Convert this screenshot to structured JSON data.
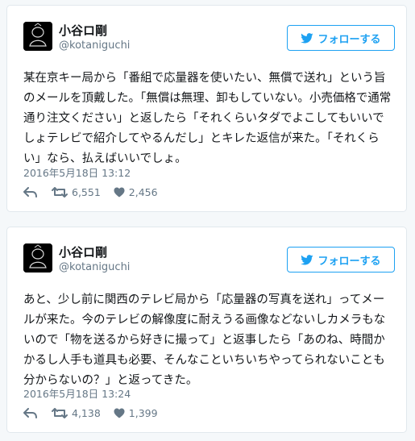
{
  "tweets": [
    {
      "display_name": "小谷ロ剛",
      "screen_name": "@kotaniguchi",
      "follow_label": "フォローする",
      "body": "某在京キー局から「番組で応量器を使いたい、無償で送れ」という旨のメールを頂戴した。「無償は無理、卸もしていない。小売価格で通常通り注文ください」と返したら「それくらいタダでよこしてもいいでしょテレビで紹介してやるんだし」とキレた返信が来た。「それくらい」なら、払えばいいでしょ。",
      "timestamp": "2016年5月18日 13:12",
      "retweets": "6,551",
      "likes": "2,456"
    },
    {
      "display_name": "小谷ロ剛",
      "screen_name": "@kotaniguchi",
      "follow_label": "フォローする",
      "body": "あと、少し前に関西のテレビ局から「応量器の写真を送れ」ってメールが来た。今のテレビの解像度に耐えうる画像などないしカメラもないので「物を送るから好きに撮って」と返事したら「あのね、時間かかるし人手も道具も必要、そんなこといちいちやってられないことも分からないの？」と返ってきた。",
      "timestamp": "2016年5月18日 13:24",
      "retweets": "4,138",
      "likes": "1,399"
    }
  ],
  "icons": {
    "follow": "twitter-bird-icon",
    "reply": "reply-arrow-icon",
    "retweet": "retweet-icon",
    "like": "heart-icon"
  },
  "colors": {
    "accent": "#1da1f2",
    "text": "#14171a",
    "muted": "#657786",
    "border": "#e1e8ed",
    "background": "#f5f8fa"
  }
}
